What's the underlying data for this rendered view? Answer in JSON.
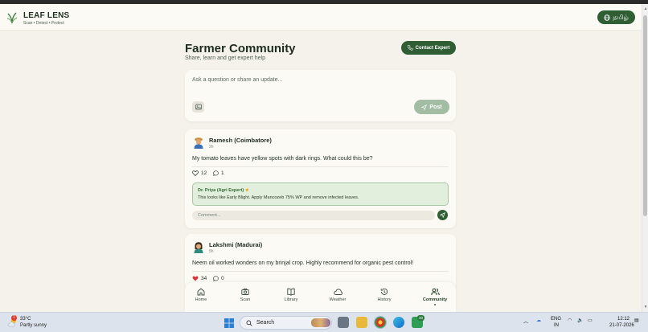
{
  "app": {
    "brand_title": "LEAF LENS",
    "brand_tagline": "Scan • Detect • Protect",
    "language_button": "தமிழ்"
  },
  "page": {
    "title": "Farmer Community",
    "subtitle": "Share, learn and get expert help",
    "contact_button": "Contact Expert"
  },
  "composer": {
    "placeholder": "Ask a question or share an update...",
    "post_button": "Post"
  },
  "posts": [
    {
      "author": "Ramesh (Coimbatore)",
      "time_ago": "2h",
      "text": "My tomato leaves have yellow spots with dark rings. What could this be?",
      "likes": "12",
      "comments": "1",
      "liked": false,
      "expert_reply": {
        "name": "Dr. Priya (Agri Expert)",
        "text": "This looks like Early Blight. Apply Mancozeb 75% WP and remove infected leaves."
      },
      "comment_placeholder": "Comment..."
    },
    {
      "author": "Lakshmi (Madurai)",
      "time_ago": "5h",
      "text": "Neem oil worked wonders on my brinjal crop. Highly recommend for organic pest control!",
      "likes": "34",
      "comments": "0",
      "liked": true
    }
  ],
  "bottom_nav": {
    "items": [
      {
        "label": "Home",
        "icon": "home-icon"
      },
      {
        "label": "Scan",
        "icon": "camera-icon"
      },
      {
        "label": "Library",
        "icon": "book-icon"
      },
      {
        "label": "Weather",
        "icon": "cloud-icon"
      },
      {
        "label": "History",
        "icon": "history-icon"
      },
      {
        "label": "Community",
        "icon": "users-icon"
      }
    ],
    "active": "Community"
  },
  "taskbar": {
    "weather_badge": "1",
    "temperature": "33°C",
    "condition": "Partly sunny",
    "search_label": "Search",
    "app_badge": "20",
    "input_language": "ENG",
    "input_region": "IN",
    "time": "12:12",
    "date": "21-07-2026"
  },
  "colors": {
    "primary": "#2f5d34",
    "background": "#f4f2ea",
    "card": "#fbfaf5",
    "expert_box": "#e3efdd",
    "like_red": "#d33a3a"
  }
}
